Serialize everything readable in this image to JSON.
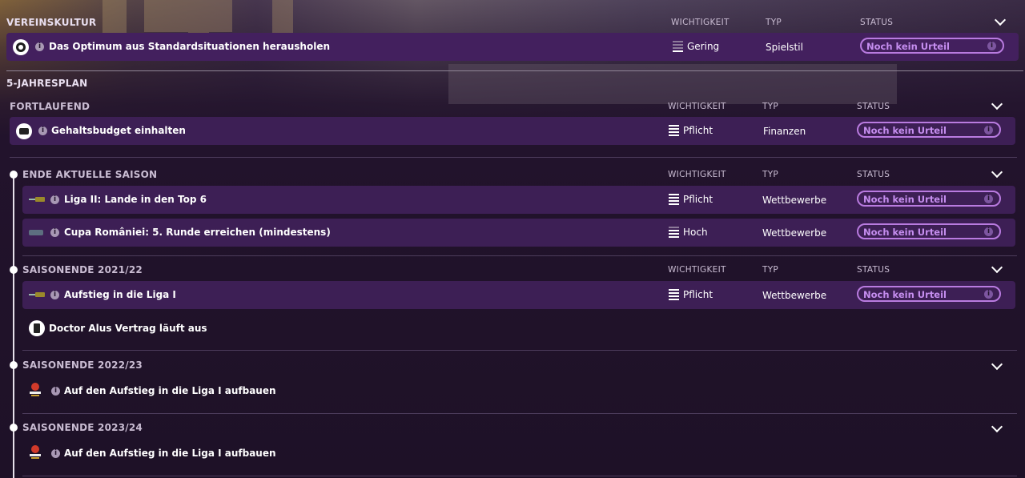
{
  "column_headers": {
    "importance": "WICHTIGKEIT",
    "type": "TYP",
    "status": "STATUS"
  },
  "vereinskultur": {
    "title": "VEREINSKULTUR",
    "row": {
      "label": "Das Optimum aus Standardsituationen herausholen",
      "importance": "Gering",
      "type": "Spielstil",
      "status": "Noch kein Urteil"
    }
  },
  "plan": {
    "title": "5-JAHRESPLAN",
    "ongoing": {
      "title": "FORTLAUFEND",
      "row": {
        "label": "Gehaltsbudget einhalten",
        "importance": "Pflicht",
        "type": "Finanzen",
        "status": "Noch kein Urteil"
      }
    },
    "season_current": {
      "title": "ENDE AKTUELLE SAISON",
      "rows": [
        {
          "label": "Liga II: Lande in den Top 6",
          "importance": "Pflicht",
          "type": "Wettbewerbe",
          "status": "Noch kein Urteil"
        },
        {
          "label": "Cupa României: 5. Runde erreichen (mindestens)",
          "importance": "Hoch",
          "type": "Wettbewerbe",
          "status": "Noch kein Urteil"
        }
      ]
    },
    "season_2122": {
      "title": "SAISONENDE 2021/22",
      "row": {
        "label": "Aufstieg in die Liga I",
        "importance": "Pflicht",
        "type": "Wettbewerbe",
        "status": "Noch kein Urteil"
      },
      "note": "Doctor Alus Vertrag läuft aus"
    },
    "season_2223": {
      "title": "SAISONENDE 2022/23",
      "item": "Auf den Aufstieg in die Liga I aufbauen"
    },
    "season_2324": {
      "title": "SAISONENDE 2023/24",
      "item": "Auf den Aufstieg in die Liga I aufbauen"
    }
  },
  "icons": {
    "info": "i",
    "ball": "football-icon",
    "money": "money-icon",
    "contract": "contract-icon",
    "trophy": "trophy-icon",
    "club": "club-badge-icon"
  }
}
